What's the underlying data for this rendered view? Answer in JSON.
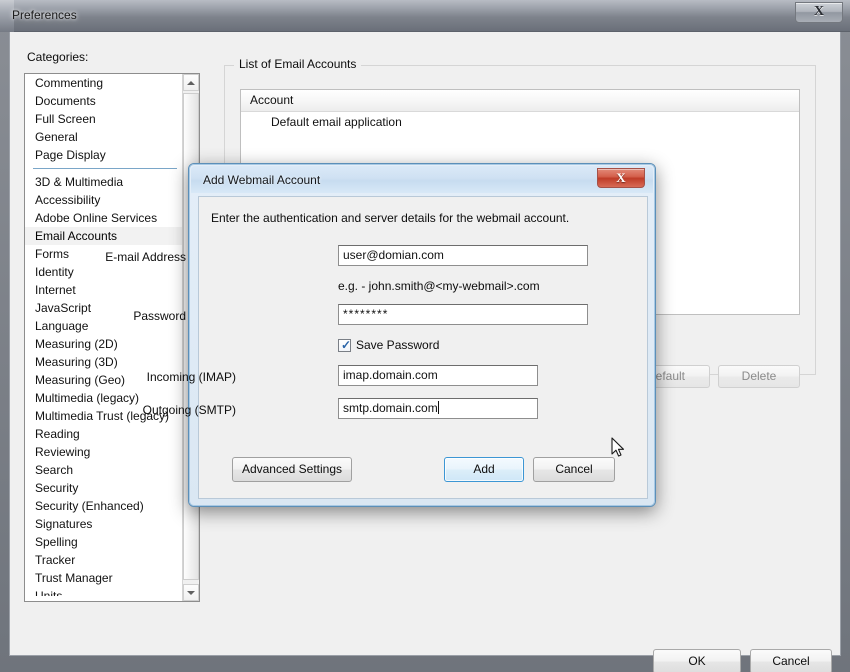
{
  "window": {
    "title": "Preferences",
    "close_glyph": "X",
    "close_icon": "close-icon"
  },
  "categories": {
    "label": "Categories:",
    "selected": "Email Accounts",
    "group_one": [
      "Commenting",
      "Documents",
      "Full Screen",
      "General",
      "Page Display"
    ],
    "group_two": [
      "3D & Multimedia",
      "Accessibility",
      "Adobe Online Services",
      "Email Accounts",
      "Forms",
      "Identity",
      "Internet",
      "JavaScript",
      "Language",
      "Measuring (2D)",
      "Measuring (3D)",
      "Measuring (Geo)",
      "Multimedia (legacy)",
      "Multimedia Trust (legacy)",
      "Reading",
      "Reviewing",
      "Search",
      "Security",
      "Security (Enhanced)",
      "Signatures",
      "Spelling",
      "Tracker",
      "Trust Manager"
    ],
    "clipped_next": "Units"
  },
  "accounts_panel": {
    "group_title": "List of Email Accounts",
    "column_header": "Account",
    "rows": [
      "Default email application"
    ],
    "buttons": {
      "default_label": "Default",
      "delete_label": "Delete"
    }
  },
  "footer": {
    "ok_label": "OK",
    "cancel_label": "Cancel"
  },
  "dialog": {
    "title": "Add Webmail Account",
    "close_glyph": "X",
    "intro": "Enter the authentication and server details for the webmail account.",
    "fields": {
      "email_label": "E-mail Address",
      "email_value": "user@domian.com",
      "email_hint": "e.g. - john.smith@<my-webmail>.com",
      "password_label": "Password",
      "password_value": "********",
      "save_password_label": "Save Password",
      "save_password_checked": true,
      "check_glyph": "✓",
      "imap_label": "Incoming (IMAP)",
      "imap_value": "imap.domain.com",
      "smtp_label": "Outgoing (SMTP)",
      "smtp_value": "smtp.domain.com"
    },
    "buttons": {
      "advanced_label": "Advanced Settings",
      "add_label": "Add",
      "cancel_label": "Cancel"
    }
  },
  "colors": {
    "dialog_accent": "#3c96d4",
    "close_red": "#bf3c28",
    "separator_blue": "#7aa6c8",
    "selection_grey": "#f2f2f2"
  }
}
